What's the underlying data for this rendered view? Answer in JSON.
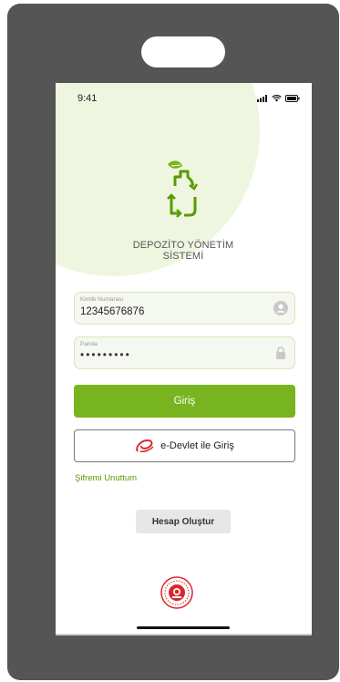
{
  "status_bar": {
    "time": "9:41"
  },
  "app": {
    "name_line1": "DEPOZİTO YÖNETİM",
    "name_line2": "SİSTEMİ"
  },
  "login_form": {
    "id_field": {
      "label": "Kimlik Numarası",
      "value": "12345676876"
    },
    "password_field": {
      "label": "Parola",
      "value": "•••••••••"
    },
    "login_button_label": "Giriş",
    "edevlet_button_label": "e-Devlet ile Giriş",
    "forgot_password_label": "Şifremi Unuttum",
    "create_account_label": "Hesap Oluştur"
  },
  "colors": {
    "accent": "#78b41f",
    "field_border": "#d6e9b4",
    "device_frame": "#555555",
    "edevlet_red": "#d9262c"
  },
  "icons": [
    "signal-icon",
    "wifi-icon",
    "battery-icon",
    "user-icon",
    "lock-icon",
    "edevlet-logo",
    "government-emblem"
  ]
}
